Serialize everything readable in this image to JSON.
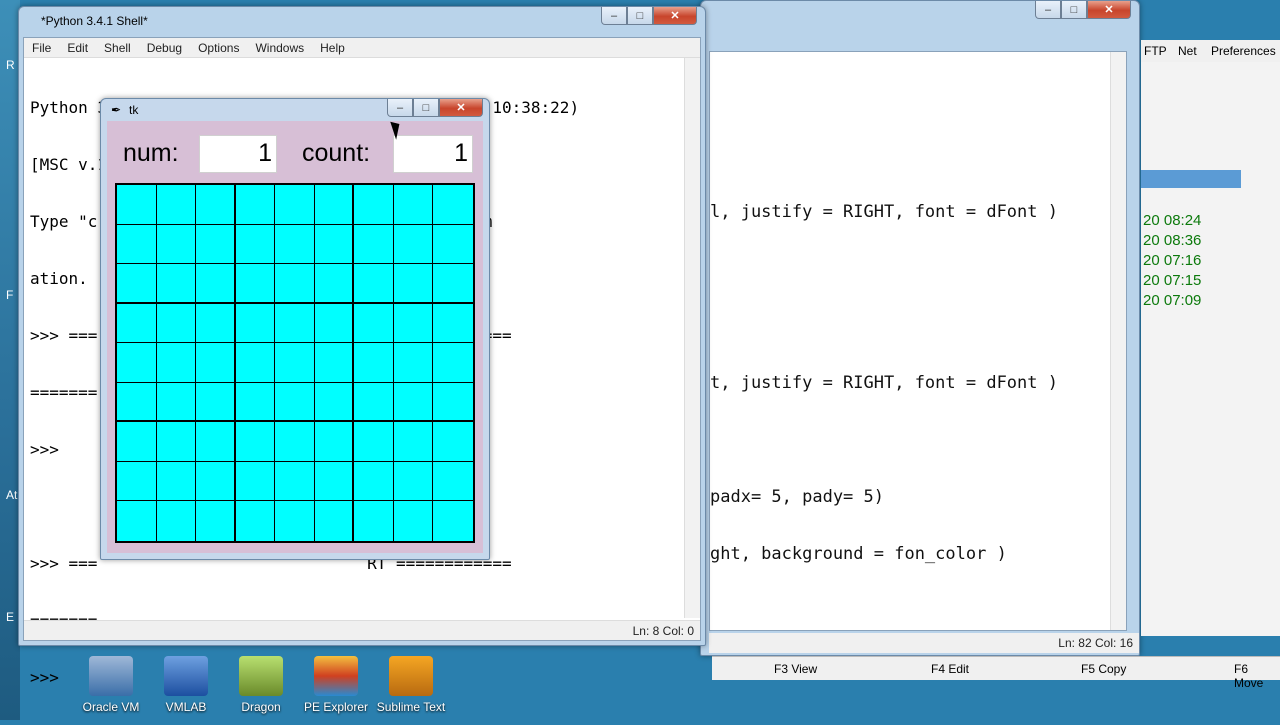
{
  "shell": {
    "title": "*Python 3.4.1 Shell*",
    "menu": [
      "File",
      "Edit",
      "Shell",
      "Debug",
      "Options",
      "Windows",
      "Help"
    ],
    "lines": [
      "Python 3.4.1 (v3.4.1:c0e311e010fc, May 18 2014, 10:38:22)",
      "[MSC v.1600 32 bit (Intel)] on win32",
      "Type \"c                        \" for more inform",
      "ation.",
      ">>> ===                            RT ============",
      "=======",
      ">>>",
      "",
      ">>> ===                            RT ============",
      "=======",
      ">>>"
    ],
    "status": "Ln: 8  Col: 0"
  },
  "editor": {
    "menu": [
      "FTP",
      "Net",
      "Preferences"
    ],
    "code": [
      "l, justify = RIGHT, font = dFont )",
      "t, justify = RIGHT, font = dFont )",
      "padx= 5, pady= 5)",
      "ght, background = fon_color )"
    ],
    "status": "Ln: 82  Col: 16",
    "times": [
      "20 08:24",
      "20 08:36",
      "20 07:16",
      "20 07:15",
      "20 07:09"
    ]
  },
  "tk": {
    "title": "tk",
    "num_label": "num:",
    "num_value": "1",
    "count_label": "count:",
    "count_value": "1",
    "grid_color": "#00ffff"
  },
  "fkeys": [
    "F3 View",
    "F4 Edit",
    "F5 Copy",
    "F6 Move"
  ],
  "desktop_icons": [
    "Oracle VM",
    "VMLAB",
    "Dragon",
    "PE Explorer",
    "Sublime Text"
  ],
  "side_letters": [
    "R",
    "F",
    "At",
    "E"
  ]
}
